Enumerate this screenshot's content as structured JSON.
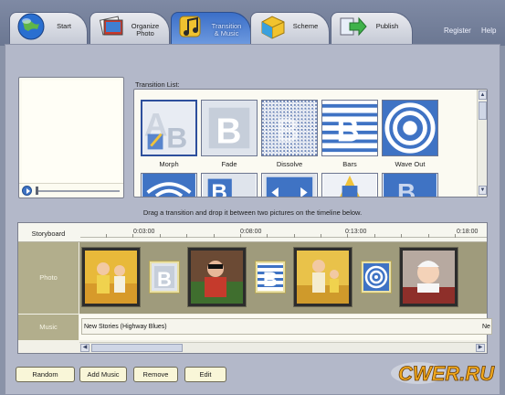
{
  "tabs": [
    {
      "label": "Start",
      "icon": "globe-icon",
      "active": false
    },
    {
      "label": "Organize\nPhoto",
      "icon": "photo-stack-icon",
      "active": false
    },
    {
      "label": "Transition\n& Music",
      "icon": "music-note-icon",
      "active": true
    },
    {
      "label": "Scheme",
      "icon": "scheme-box-icon",
      "active": false
    },
    {
      "label": "Publish",
      "icon": "publish-arrow-icon",
      "active": false
    }
  ],
  "header": {
    "register": "Register",
    "help": "Help"
  },
  "transition_list": {
    "label": "Transition List:",
    "items": [
      {
        "name": "Morph",
        "selected": true,
        "icon": "morph-ab-icon"
      },
      {
        "name": "Fade",
        "selected": false,
        "icon": "fade-b-icon"
      },
      {
        "name": "Dissolve",
        "selected": false,
        "icon": "dissolve-icon"
      },
      {
        "name": "Bars",
        "selected": false,
        "icon": "bars-b-icon"
      },
      {
        "name": "Wave Out",
        "selected": false,
        "icon": "wave-out-icon"
      }
    ]
  },
  "hint": "Drag a transition and drop it between two pictures on the timeline below.",
  "storyboard": {
    "title": "Storyboard",
    "ticks": [
      "0:03:00",
      "0:08:00",
      "0:13:00",
      "0:18:00"
    ],
    "photo_label": "Photo",
    "music_label": "Music",
    "music_track": "New Stories (Highway Blues)",
    "music_track_next": "Ne"
  },
  "buttons": {
    "random": "Random",
    "add_music": "Add Music",
    "remove": "Remove",
    "edit": "Edit"
  },
  "watermark": "CWER.RU",
  "colors": {
    "accent": "#3b6fc8",
    "panel": "#b3b8c9",
    "storyboard_row": "#9f9b7c",
    "button_bg": "#f9f6d8"
  }
}
